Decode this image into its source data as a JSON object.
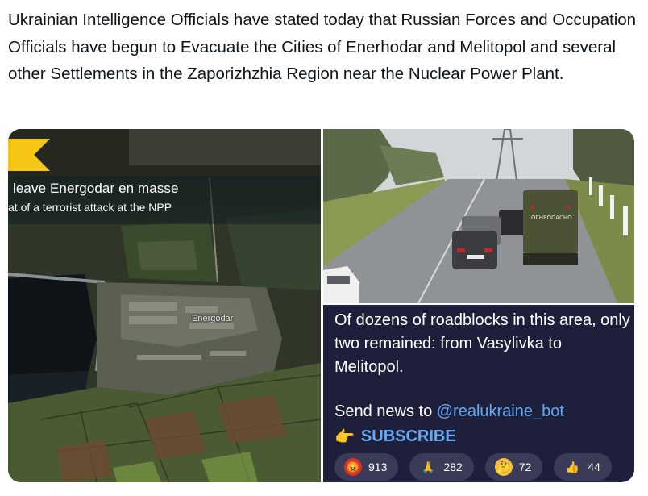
{
  "tweet": {
    "text": "Ukrainian Intelligence Officials have stated today that Russian Forces and Occupation Officials have begun to Evacuate the Cities of Enerhodar and Melitopol and several other Settlements in the Zaporizhzhia Region near the Nuclear Power Plant."
  },
  "media": {
    "map": {
      "headline": "leave Energodar en masse",
      "subline": "at of a terrorist attack at the NPP",
      "place_label": "Energodar",
      "accent_color": "#f5c518"
    },
    "road_photo": {
      "truck_label": "ОГНЕОПАСНО"
    },
    "telegram": {
      "message": "Of dozens of roadblocks in this area, only two remained: from Vasylivka to Melitopol.",
      "send_prefix": "Send news to ",
      "handle": "@realukraine_bot",
      "subscribe": "SUBSCRIBE",
      "subscribe_icon": "pointing-hand-icon",
      "background_color": "#1e1f3a",
      "link_color": "#67a8f5",
      "reactions": [
        {
          "icon": "angry-face-icon",
          "glyph": "😡",
          "count": "913"
        },
        {
          "icon": "praying-hands-icon",
          "glyph": "🙏",
          "count": "282"
        },
        {
          "icon": "thinking-face-icon",
          "glyph": "🤔",
          "count": "72"
        },
        {
          "icon": "thumbs-up-icon",
          "glyph": "👍",
          "count": "44"
        }
      ]
    }
  }
}
